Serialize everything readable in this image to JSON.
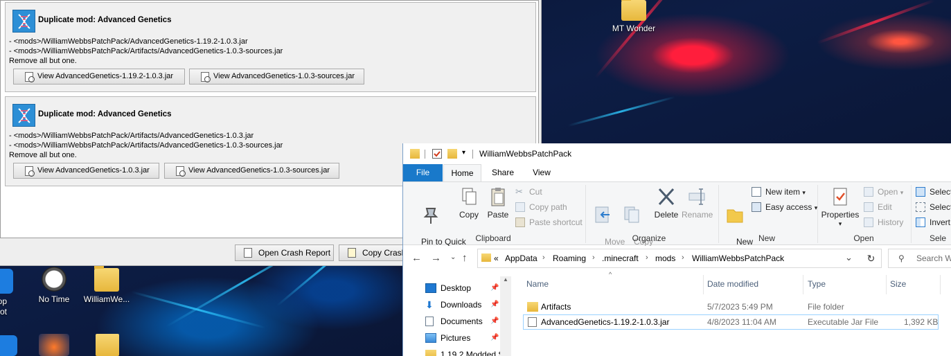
{
  "colors": {
    "accent_blue": "#1979ca",
    "folder_yellow": "#e7b73c",
    "selection_border": "#99d1ff"
  },
  "desktop": {
    "icons": [
      {
        "label": "MT Wonder",
        "icon": "folder-icon"
      },
      {
        "label": "op\nenshot",
        "icon": "camera-icon"
      },
      {
        "label": "No Time",
        "icon": "clock-icon"
      },
      {
        "label": "WilliamWe...",
        "icon": "folder-icon"
      }
    ]
  },
  "crash_dialog": {
    "entries": [
      {
        "title": "Duplicate mod: Advanced Genetics",
        "lines": [
          "- <mods>/WilliamWebbsPatchPack/AdvancedGenetics-1.19.2-1.0.3.jar",
          "- <mods>/WilliamWebbsPatchPack/Artifacts/AdvancedGenetics-1.0.3-sources.jar",
          "Remove all but one."
        ],
        "buttons": [
          "View AdvancedGenetics-1.19.2-1.0.3.jar",
          "View AdvancedGenetics-1.0.3-sources.jar"
        ]
      },
      {
        "title": "Duplicate mod: Advanced Genetics",
        "lines": [
          "- <mods>/WilliamWebbsPatchPack/Artifacts/AdvancedGenetics-1.0.3.jar",
          "- <mods>/WilliamWebbsPatchPack/Artifacts/AdvancedGenetics-1.0.3-sources.jar",
          "Remove all but one."
        ],
        "buttons": [
          "View AdvancedGenetics-1.0.3.jar",
          "View AdvancedGenetics-1.0.3-sources.jar"
        ]
      }
    ],
    "bottom_buttons": [
      "Open Crash Report",
      "Copy Crash"
    ]
  },
  "explorer": {
    "title": "WilliamWebbsPatchPack",
    "tabs": [
      "File",
      "Home",
      "Share",
      "View"
    ],
    "ribbon": {
      "clipboard": {
        "label": "Clipboard",
        "pin": "Pin to Quick\naccess",
        "copy": "Copy",
        "paste": "Paste",
        "cut": "Cut",
        "copy_path": "Copy path",
        "paste_shortcut": "Paste shortcut"
      },
      "organize": {
        "label": "Organize",
        "move_to": "Move\nto",
        "copy_to": "Copy\nto",
        "delete": "Delete",
        "rename": "Rename"
      },
      "new": {
        "label": "New",
        "new_folder": "New\nfolder",
        "new_item": "New item",
        "easy_access": "Easy access"
      },
      "open": {
        "label": "Open",
        "properties": "Properties",
        "open": "Open",
        "edit": "Edit",
        "history": "History"
      },
      "select": {
        "label": "Sele",
        "select_all": "Select",
        "select_none": "Select",
        "invert": "Invert"
      }
    },
    "address": {
      "prefix": "«",
      "crumbs": [
        "AppData",
        "Roaming",
        ".minecraft",
        "mods",
        "WilliamWebbsPatchPack"
      ],
      "search_placeholder": "Search W"
    },
    "nav": [
      {
        "label": "Desktop",
        "pinned": true
      },
      {
        "label": "Downloads",
        "pinned": true
      },
      {
        "label": "Documents",
        "pinned": true
      },
      {
        "label": "Pictures",
        "pinned": true
      },
      {
        "label": "1.19.2 Modded S",
        "pinned": false
      }
    ],
    "columns": [
      "Name",
      "Date modified",
      "Type",
      "Size"
    ],
    "files": [
      {
        "name": "Artifacts",
        "date": "5/7/2023 5:49 PM",
        "type": "File folder",
        "size": ""
      },
      {
        "name": "AdvancedGenetics-1.19.2-1.0.3.jar",
        "date": "4/8/2023 11:04 AM",
        "type": "Executable Jar File",
        "size": "1,392 KB"
      }
    ]
  }
}
